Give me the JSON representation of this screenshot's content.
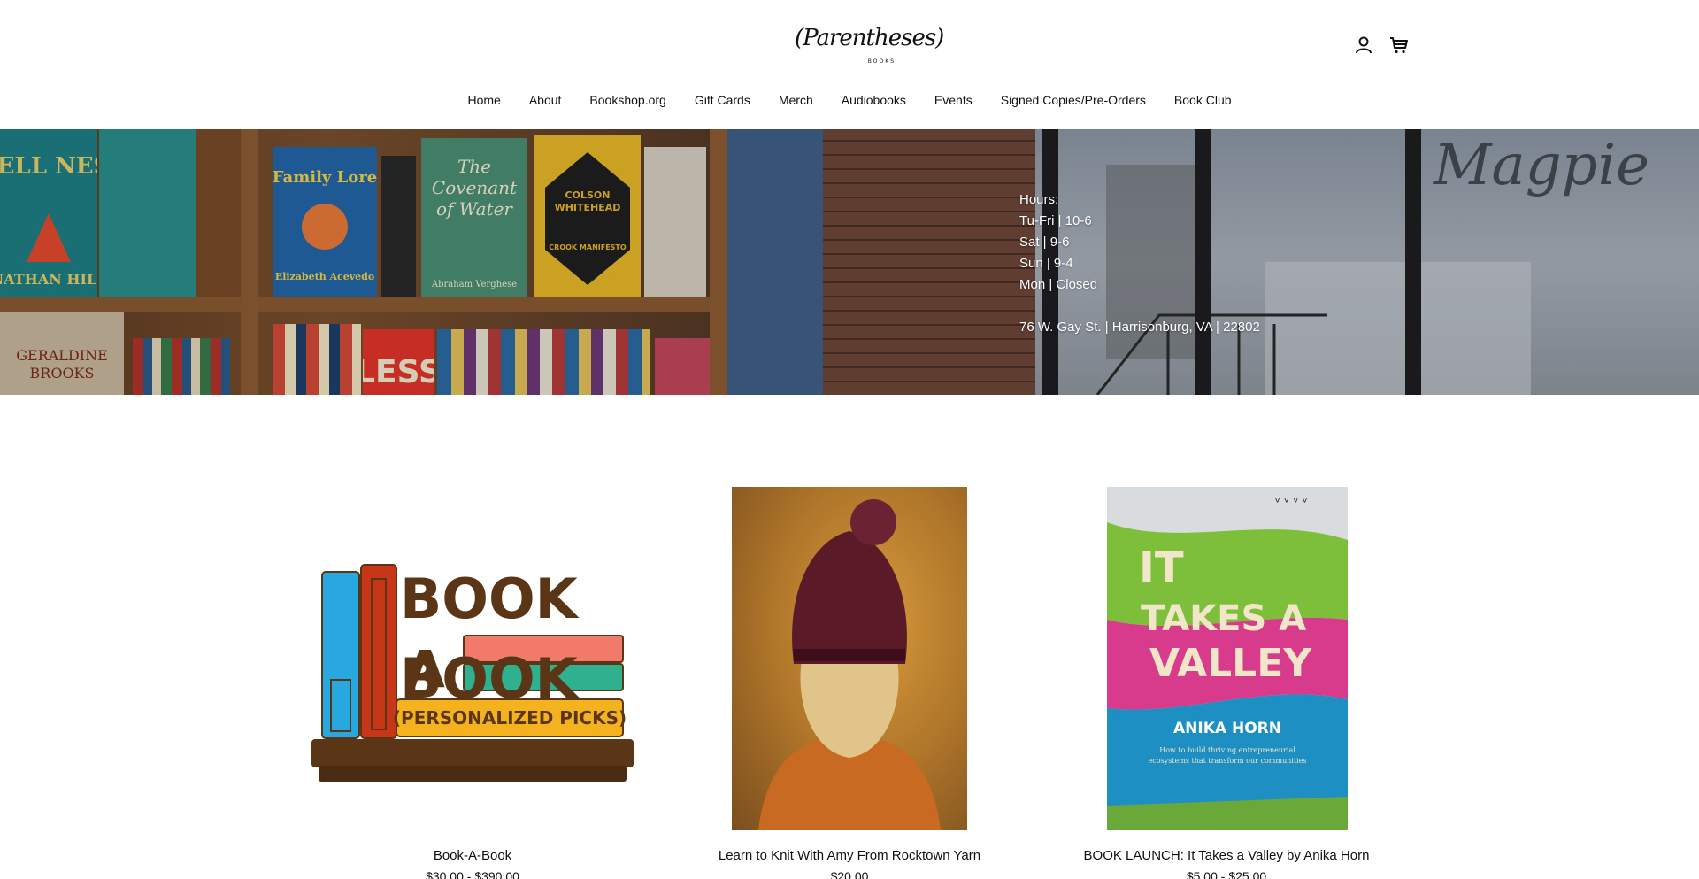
{
  "header": {
    "logo_text": "(Parentheses)",
    "logo_subtext": "BOOKS",
    "account_icon": "account-icon",
    "cart_icon": "cart-icon"
  },
  "nav": {
    "items": [
      "Home",
      "About",
      "Bookshop.org",
      "Gift Cards",
      "Merch",
      "Audiobooks",
      "Events",
      "Signed Copies/Pre-Orders",
      "Book Club"
    ]
  },
  "hero": {
    "hours_label": "Hours:",
    "hours_lines": [
      "Tu-Fri | 10-6",
      "Sat | 9-6",
      "Sun | 9-4",
      "Mon | Closed"
    ],
    "address": "76 W. Gay St. | Harrisonburg, VA | 22802",
    "window_sign": "Magpie",
    "book_spines": [
      "WELL NESS",
      "NATHAN HILL",
      "Family Lore",
      "Elizabeth Acevedo",
      "The Covenant of Water",
      "Abraham Verghese",
      "COLSON WHITEHEAD",
      "CROOK MANIFESTO",
      "GERALDINE BROOKS",
      "LESS"
    ]
  },
  "products": [
    {
      "title": "Book-A-Book",
      "price": "$30.00 - $390.00",
      "image_text": [
        "BOOK",
        "A",
        "BOOK",
        "(PERSONALIZED PICKS)"
      ]
    },
    {
      "title": "Learn to Knit With Amy From Rocktown Yarn",
      "price": "$20.00"
    },
    {
      "title": "BOOK LAUNCH: It Takes a Valley by Anika Horn",
      "price": "$5.00 - $25.00",
      "image_text": [
        "IT",
        "TAKES A",
        "VALLEY",
        "ANIKA HORN",
        "How to build thriving entrepreneurial ecosystems that transform our communities"
      ]
    }
  ],
  "colors": {
    "hero_text": "#ffffff",
    "bab_brown": "#5a3616",
    "bab_blue": "#29a8e0",
    "bab_red": "#c8361a",
    "bab_salmon": "#f27a6b",
    "bab_teal": "#2fb08f",
    "bab_yellow": "#f3b21e",
    "beanie": "#5a1a28",
    "valley_pink": "#d83b8b",
    "valley_green": "#7dbf3b",
    "valley_blue": "#1e8fc2"
  }
}
